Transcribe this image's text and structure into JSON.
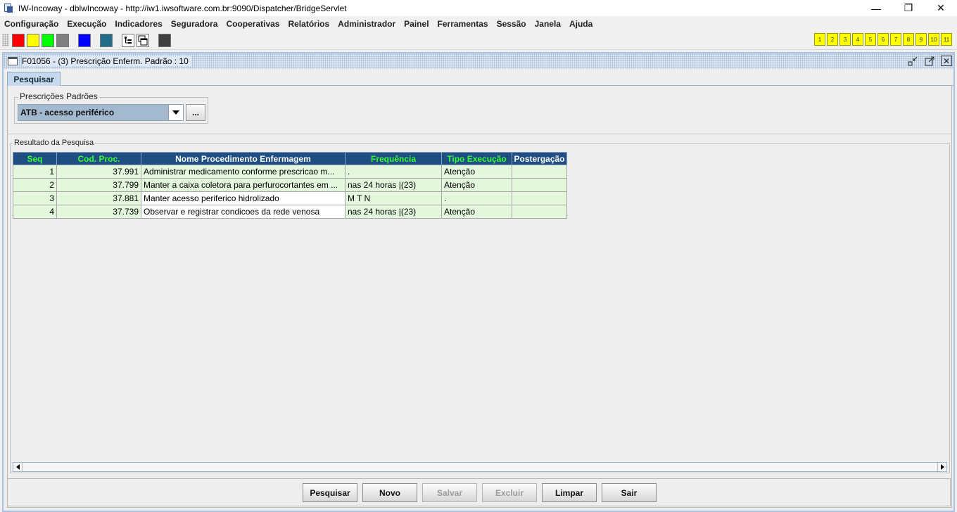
{
  "window": {
    "title": "IW-Incoway - dblwIncoway - http://iw1.iwsoftware.com.br:9090/Dispatcher/BridgeServlet",
    "controls": [
      "—",
      "❐",
      "✕"
    ]
  },
  "menu": [
    "Configuração",
    "Execução",
    "Indicadores",
    "Seguradora",
    "Cooperativas",
    "Relatórios",
    "Administrador",
    "Painel",
    "Ferramentas",
    "Sessão",
    "Janela",
    "Ajuda"
  ],
  "toolbar": {
    "swatches": [
      "#ff0000",
      "#ffff00",
      "#00ff00",
      "#808080",
      "#0000ff",
      "#1f6f8b",
      "#404040"
    ],
    "icons": [
      "tree-view-icon",
      "windows-icon"
    ],
    "numbers": [
      "1",
      "2",
      "3",
      "4",
      "5",
      "6",
      "7",
      "8",
      "9",
      "10",
      "11"
    ]
  },
  "frame": {
    "title": "F01056 - (3) Prescrição Enferm. Padrão : 10",
    "tab": "Pesquisar"
  },
  "search": {
    "group_label": "Prescrições Padrões",
    "combo_value": "ATB - acesso periférico",
    "ellipsis": "..."
  },
  "results": {
    "group_label": "Resultado da Pesquisa",
    "columns": [
      "Seq",
      "Cod. Proc.",
      "Nome Procedimento Enfermagem",
      "Frequência",
      "Tipo Execução",
      "Postergação"
    ],
    "rows": [
      [
        "1",
        "37.991",
        "Administrar medicamento conforme prescricao m...",
        ".",
        "Atenção",
        ""
      ],
      [
        "2",
        "37.799",
        "Manter a caixa coletora para perfurocortantes em ...",
        "nas 24 horas |(23)",
        "Atenção",
        ""
      ],
      [
        "3",
        "37.881",
        "Manter acesso periferico hidrolizado",
        "M T N",
        ".",
        ""
      ],
      [
        "4",
        "37.739",
        "Observar e registrar condicoes da rede venosa",
        "nas 24 horas |(23)",
        "Atenção",
        ""
      ]
    ]
  },
  "buttons": {
    "pesquisar": "Pesquisar",
    "novo": "Novo",
    "salvar": "Salvar",
    "excluir": "Excluir",
    "limpar": "Limpar",
    "sair": "Sair"
  }
}
